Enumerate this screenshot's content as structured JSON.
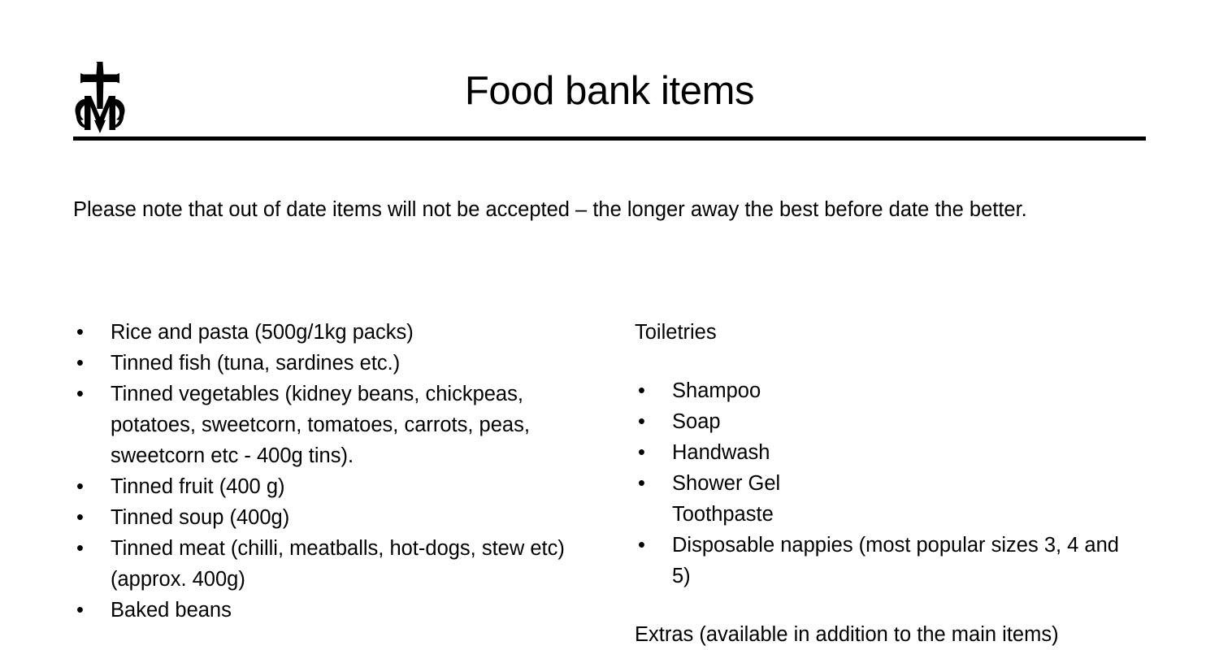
{
  "header": {
    "title": "Food bank items",
    "logo_name": "marian-cross-monogram-logo"
  },
  "intro": {
    "text": "Please note that out of date items will not be accepted – the longer away the best before date the better."
  },
  "columns": {
    "left": {
      "items": [
        {
          "text": "Rice and pasta (500g/1kg packs)",
          "bulleted": true
        },
        {
          "text": "Tinned fish (tuna, sardines etc.)",
          "bulleted": true
        },
        {
          "text": "Tinned vegetables (kidney beans, chickpeas, potatoes, sweetcorn, tomatoes, carrots, peas, sweetcorn etc - 400g tins).",
          "bulleted": true
        },
        {
          "text": "Tinned fruit (400 g)",
          "bulleted": true
        },
        {
          "text": "Tinned soup (400g)",
          "bulleted": true
        },
        {
          "text": "Tinned meat (chilli, meatballs, hot-dogs, stew etc) (approx. 400g)",
          "bulleted": true
        },
        {
          "text": "Baked beans",
          "bulleted": true
        }
      ]
    },
    "right": {
      "heading": "Toiletries",
      "items": [
        {
          "text": "Shampoo",
          "bulleted": true
        },
        {
          "text": "Soap",
          "bulleted": true
        },
        {
          "text": "Handwash",
          "bulleted": true
        },
        {
          "text": "Shower Gel",
          "bulleted": true
        },
        {
          "text": "Toothpaste",
          "bulleted": false
        },
        {
          "text": "Disposable nappies (most popular sizes 3, 4 and 5)",
          "bulleted": true
        }
      ],
      "tail_heading": "Extras (available in addition to the main items)"
    }
  },
  "colors": {
    "background": "#ffffff",
    "text": "#000000",
    "rule": "#000000"
  }
}
